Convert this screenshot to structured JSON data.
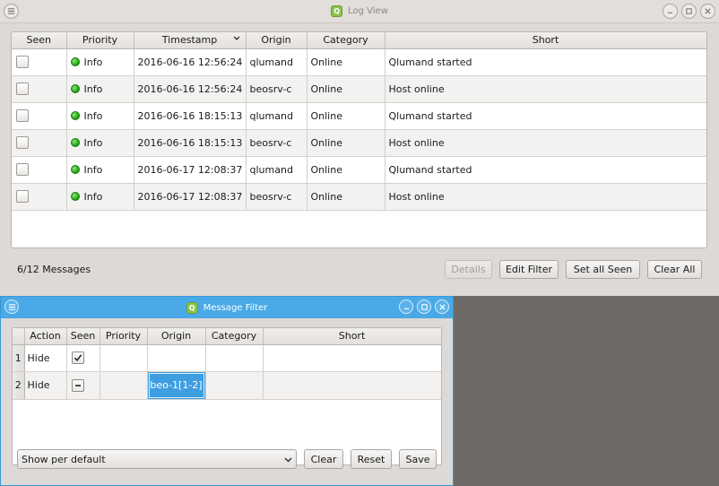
{
  "log_window": {
    "title": "Log View",
    "app_icon_letter": "Q",
    "columns": [
      "Seen",
      "Priority",
      "Timestamp",
      "Origin",
      "Category",
      "Short"
    ],
    "rows": [
      {
        "priority": "Info",
        "timestamp": "2016-06-16 12:56:24",
        "origin": "qlumand",
        "category": "Online",
        "short": "Qlumand started"
      },
      {
        "priority": "Info",
        "timestamp": "2016-06-16 12:56:24",
        "origin": "beosrv-c",
        "category": "Online",
        "short": "Host online"
      },
      {
        "priority": "Info",
        "timestamp": "2016-06-16 18:15:13",
        "origin": "qlumand",
        "category": "Online",
        "short": "Qlumand started"
      },
      {
        "priority": "Info",
        "timestamp": "2016-06-16 18:15:13",
        "origin": "beosrv-c",
        "category": "Online",
        "short": "Host online"
      },
      {
        "priority": "Info",
        "timestamp": "2016-06-17 12:08:37",
        "origin": "qlumand",
        "category": "Online",
        "short": "Qlumand started"
      },
      {
        "priority": "Info",
        "timestamp": "2016-06-17 12:08:37",
        "origin": "beosrv-c",
        "category": "Online",
        "short": "Host online"
      }
    ],
    "message_count": "6/12 Messages",
    "buttons": {
      "details": "Details",
      "edit_filter": "Edit Filter",
      "set_all_seen": "Set all Seen",
      "clear_all": "Clear All"
    },
    "priority_color": "#2fbf1f"
  },
  "filter_window": {
    "title": "Message Filter",
    "app_icon_letter": "Q",
    "columns": [
      "Action",
      "Seen",
      "Priority",
      "Origin",
      "Category",
      "Short"
    ],
    "rows": [
      {
        "num": "1",
        "action": "Hide",
        "seen": "checked",
        "priority": "",
        "origin": "",
        "category": "",
        "short": ""
      },
      {
        "num": "2",
        "action": "Hide",
        "seen": "partial",
        "priority": "",
        "origin": "beo-1[1-2]",
        "category": "",
        "short": ""
      }
    ],
    "default_select": "Show per default",
    "buttons": {
      "clear": "Clear",
      "reset": "Reset",
      "save": "Save"
    },
    "accent_color": "#49a9e6"
  }
}
